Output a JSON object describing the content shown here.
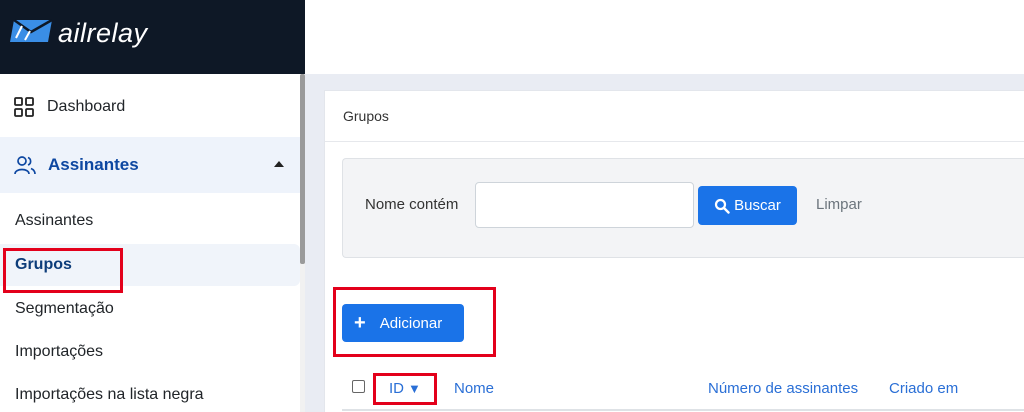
{
  "brand": {
    "logo_text": "ailrelay"
  },
  "sidebar": {
    "dashboard": "Dashboard",
    "assinantes": "Assinantes",
    "sub_items": {
      "assinantes": "Assinantes",
      "grupos": "Grupos",
      "segmentacao": "Segmentação",
      "importacoes": "Importações",
      "lista_negra": "Importações na lista negra"
    }
  },
  "main": {
    "title": "Grupos",
    "filter": {
      "label": "Nome contém",
      "value": "",
      "search_button": "Buscar",
      "clear_link": "Limpar"
    },
    "add_button": "Adicionar",
    "table": {
      "columns": {
        "id": "ID",
        "name": "Nome",
        "subscriber_count": "Número de assinantes",
        "created_at": "Criado em"
      },
      "sort_indicator": "▼"
    }
  },
  "colors": {
    "primary": "#1a73e8",
    "sidebar_header": "#0e1826",
    "highlight": "#e3001b",
    "active_text": "#0d47a1"
  },
  "icons": {
    "dashboard": "grid-icon",
    "assinantes": "users-icon",
    "buscar": "search-icon",
    "adicionar": "plus-icon",
    "logo": "mail-icon"
  }
}
